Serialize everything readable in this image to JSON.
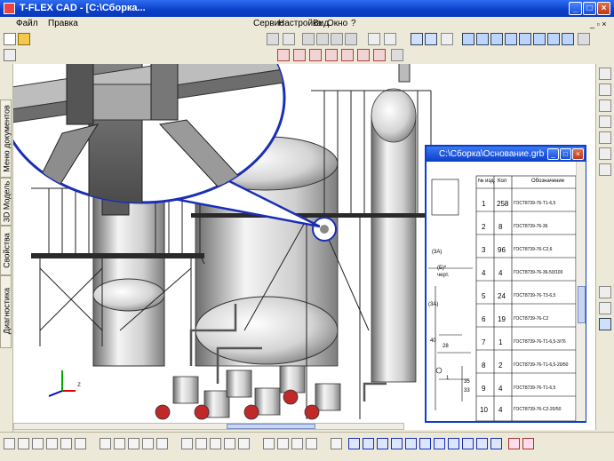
{
  "window": {
    "title": "T-FLEX CAD - [C:\\Сборка...",
    "accent": "#0a3fc8"
  },
  "menu": {
    "items": [
      "Файл",
      "Правка",
      "Сервис",
      "Настройка",
      "Вид",
      "Окно",
      "?"
    ]
  },
  "left_tabs": [
    "Диагностика",
    "Свойства",
    "3D Модель",
    "Меню документов"
  ],
  "subwindow": {
    "title": "C:\\Сборка\\Основание.grb"
  },
  "table": {
    "headers": [
      "№ изд.",
      "Кол",
      "Обозначение"
    ],
    "rows": [
      {
        "n": "1",
        "qty": "258",
        "code": "ГОСТ8739-76-Т1-6,5"
      },
      {
        "n": "2",
        "qty": "8",
        "code": "ГОСТ8739-76-36"
      },
      {
        "n": "3",
        "qty": "96",
        "code": "ГОСТ8739-76-С2,6"
      },
      {
        "n": "4",
        "qty": "4",
        "code": "ГОСТ8739-76-36-50/100"
      },
      {
        "n": "5",
        "qty": "24",
        "code": "ГОСТ8739-76-Т3-6,5"
      },
      {
        "n": "6",
        "qty": "19",
        "code": "ГОСТ8739-76-С2"
      },
      {
        "n": "7",
        "qty": "1",
        "code": "ГОСТ8739-76-Т1-6,5-3/76"
      },
      {
        "n": "8",
        "qty": "2",
        "code": "ГОСТ8739-76-Т1-6,5-20/50"
      },
      {
        "n": "9",
        "qty": "4",
        "code": "ГОСТ8739-76-Т1-6,5"
      },
      {
        "n": "10",
        "qty": "4",
        "code": "ГОСТ8739-76-С2-20/50"
      }
    ]
  },
  "drawing_labels": [
    "(3А)",
    "(3А)",
    "(Б)*",
    "черт.",
    "40",
    "28",
    "35",
    "33",
    "1"
  ],
  "axes": {
    "x": "x",
    "y": "y",
    "z": "z"
  },
  "icons": [
    "new-icon",
    "open-icon",
    "save-icon",
    "print-icon",
    "undo-icon",
    "redo-icon",
    "zoom-icon",
    "pan-icon",
    "rotate-icon",
    "grid-icon",
    "layers-icon"
  ]
}
